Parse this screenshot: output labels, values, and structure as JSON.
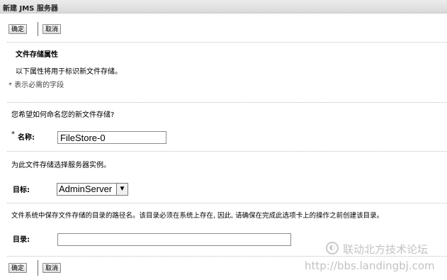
{
  "title": "新建 JMS 服务器",
  "buttons": {
    "ok": "确定",
    "cancel": "取消"
  },
  "section": {
    "heading": "文件存储属性",
    "description": "以下属性将用于标识新文件存储。",
    "required_note": "* 表示必需的字段"
  },
  "name_block": {
    "question": "您希望如何命名您的新文件存储?",
    "asterisk": "*",
    "label": "名称:",
    "value": "FileStore-0"
  },
  "target_block": {
    "question": "为此文件存储选择服务器实例。",
    "label": "目标:",
    "selected": "AdminServer"
  },
  "directory_block": {
    "question": "文件系统中保存文件存储的目录的路径名。该目录必须在系统上存在, 因此, 请确保在完成此选项卡上的操作之前创建该目录。",
    "label": "目录:",
    "value": ""
  },
  "watermark": {
    "line1": "联动北方技术论坛",
    "line2": "http://bbs.landingbj.com"
  }
}
